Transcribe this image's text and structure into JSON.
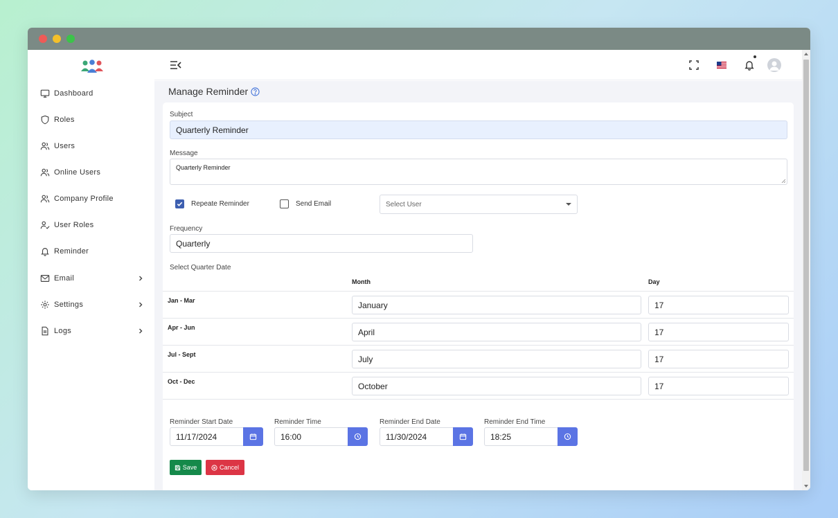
{
  "sidebar": {
    "items": [
      {
        "label": "Dashboard",
        "icon": "monitor-icon"
      },
      {
        "label": "Roles",
        "icon": "shield-icon"
      },
      {
        "label": "Users",
        "icon": "users-icon"
      },
      {
        "label": "Online Users",
        "icon": "users-icon"
      },
      {
        "label": "Company Profile",
        "icon": "users-icon"
      },
      {
        "label": "User Roles",
        "icon": "user-check-icon"
      },
      {
        "label": "Reminder",
        "icon": "bell-icon"
      },
      {
        "label": "Email",
        "icon": "mail-icon"
      },
      {
        "label": "Settings",
        "icon": "gear-icon"
      },
      {
        "label": "Logs",
        "icon": "file-icon"
      }
    ]
  },
  "page": {
    "title": "Manage Reminder"
  },
  "form": {
    "subject_label": "Subject",
    "subject_value": "Quarterly Reminder",
    "message_label": "Message",
    "message_value": "Quarterly Reminder",
    "repeat_label": "Repeate Reminder",
    "repeat_checked": true,
    "send_email_label": "Send Email",
    "send_email_checked": false,
    "select_user_placeholder": "Select User",
    "frequency_label": "Frequency",
    "frequency_value": "Quarterly",
    "quarter_label": "Select Quarter Date",
    "col_month": "Month",
    "col_day": "Day",
    "quarters": [
      {
        "label": "Jan - Mar",
        "month": "January",
        "day": "17"
      },
      {
        "label": "Apr - Jun",
        "month": "April",
        "day": "17"
      },
      {
        "label": "Jul - Sept",
        "month": "July",
        "day": "17"
      },
      {
        "label": "Oct - Dec",
        "month": "October",
        "day": "17"
      }
    ],
    "start_date_label": "Reminder Start Date",
    "start_date_value": "11/17/2024",
    "time_label": "Reminder Time",
    "time_value": "16:00",
    "end_date_label": "Reminder End Date",
    "end_date_value": "11/30/2024",
    "end_time_label": "Reminder End Time",
    "end_time_value": "18:25",
    "save_label": "Save",
    "cancel_label": "Cancel"
  },
  "colors": {
    "accent": "#5b74e4",
    "save": "#15894a",
    "cancel": "#dc3545",
    "checkbox": "#3d5fb0"
  }
}
